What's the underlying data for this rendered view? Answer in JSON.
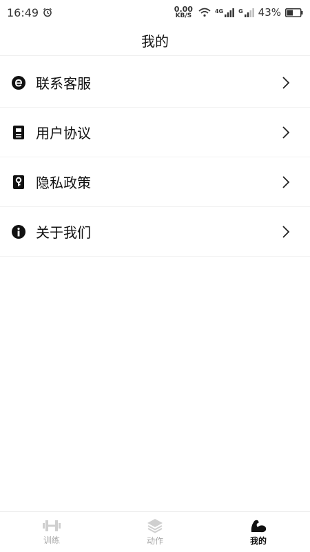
{
  "status_bar": {
    "time": "16:49",
    "net_speed_value": "0.00",
    "net_speed_unit": "KB/S",
    "signal_4g": "4G",
    "signal_g": "G",
    "battery": "43%"
  },
  "header": {
    "title": "我的"
  },
  "menu": {
    "items": [
      {
        "label": "联系客服",
        "icon": "customer-service-icon"
      },
      {
        "label": "用户协议",
        "icon": "document-icon"
      },
      {
        "label": "隐私政策",
        "icon": "key-lock-icon"
      },
      {
        "label": "关于我们",
        "icon": "info-icon"
      }
    ]
  },
  "bottom_nav": {
    "items": [
      {
        "label": "训练",
        "icon": "dumbbell-icon",
        "active": false
      },
      {
        "label": "动作",
        "icon": "layers-icon",
        "active": false
      },
      {
        "label": "我的",
        "icon": "muscle-arm-icon",
        "active": true
      }
    ]
  },
  "colors": {
    "text_primary": "#111111",
    "nav_inactive": "#aaaaaa"
  }
}
